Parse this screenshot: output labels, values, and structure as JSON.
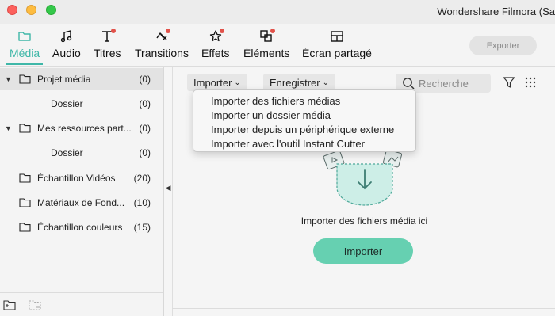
{
  "window": {
    "title": "Wondershare Filmora (Sa"
  },
  "toolbar": {
    "tabs": [
      {
        "label": "Média",
        "icon": "folder-icon",
        "active": true,
        "dot": false
      },
      {
        "label": "Audio",
        "icon": "music-note-icon",
        "active": false,
        "dot": false
      },
      {
        "label": "Titres",
        "icon": "text-t-icon",
        "active": false,
        "dot": true
      },
      {
        "label": "Transitions",
        "icon": "transition-icon",
        "active": false,
        "dot": true
      },
      {
        "label": "Effets",
        "icon": "effects-star-icon",
        "active": false,
        "dot": true
      },
      {
        "label": "Éléments",
        "icon": "elements-icon",
        "active": false,
        "dot": true
      },
      {
        "label": "Écran partagé",
        "icon": "split-screen-icon",
        "active": false,
        "dot": false
      }
    ],
    "export_label": "Exporter"
  },
  "sidebar": {
    "items": [
      {
        "label": "Projet média",
        "count": "(0)",
        "expandable": true,
        "selected": true
      },
      {
        "label": "Dossier",
        "count": "(0)",
        "expandable": false,
        "selected": false
      },
      {
        "label": "Mes ressources part...",
        "count": "(0)",
        "expandable": true,
        "selected": false
      },
      {
        "label": "Dossier",
        "count": "(0)",
        "expandable": false,
        "selected": false
      },
      {
        "label": "Échantillon Vidéos",
        "count": "(20)",
        "expandable": false,
        "selected": false
      },
      {
        "label": "Matériaux de Fond...",
        "count": "(10)",
        "expandable": false,
        "selected": false
      },
      {
        "label": "Échantillon couleurs",
        "count": "(15)",
        "expandable": false,
        "selected": false
      }
    ]
  },
  "main": {
    "import_dropdown_label": "Importer",
    "record_dropdown_label": "Enregistrer",
    "search_placeholder": "Recherche",
    "drop_text": "Importer des fichiers média ici",
    "import_button_label": "Importer"
  },
  "import_menu": {
    "items": [
      "Importer des fichiers médias",
      "Importer un dossier média",
      "Importer depuis un périphérique externe",
      "Importer avec l'outil Instant Cutter"
    ]
  },
  "colors": {
    "accent": "#3fb7a8",
    "import_button": "#66d0b1",
    "notification_dot": "#e2524a"
  }
}
